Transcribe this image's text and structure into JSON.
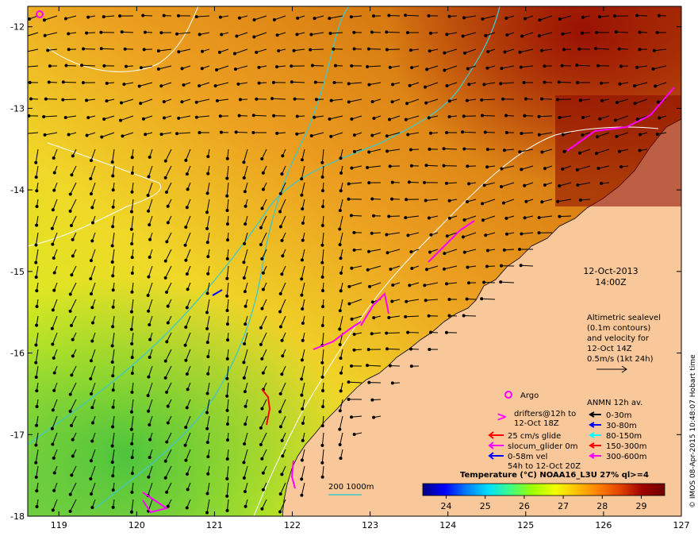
{
  "map": {
    "lon_ticks": [
      "119",
      "120",
      "121",
      "122",
      "123",
      "124",
      "125",
      "126",
      "127"
    ],
    "lat_ticks": [
      "-12",
      "-13",
      "-14",
      "-15",
      "-16",
      "-17",
      "-18"
    ],
    "lon_range": [
      118.6,
      127
    ],
    "lat_range": [
      -18,
      -11.75
    ]
  },
  "annotations": {
    "date": "12-Oct-2013",
    "time": "14:00Z",
    "alt_line1": "Altimetric sealevel",
    "alt_line2": "(0.1m contours)",
    "alt_line3": "and velocity for",
    "alt_line4": "12-Oct 14Z",
    "alt_line5": "0.5m/s (1kt 24h)",
    "argo": "Argo",
    "drifters_line1": "drifters@12h to",
    "drifters_line2": "12-Oct 18Z",
    "glide": "25 cm/s glide",
    "slocum": "slocum_glider 0m",
    "vel_line1": "0-58m vel",
    "vel_line2": "54h to 12-Oct 20Z",
    "anmn_title": "ANMN 12h av.",
    "anmn_items": [
      "0-30m",
      "30-80m",
      "80-150m",
      "150-300m",
      "300-600m"
    ],
    "anmn_colors": [
      "#000000",
      "#0000ff",
      "#00ffff",
      "#ff0000",
      "#ff00ff"
    ],
    "depth_label": "200  1000m",
    "credit": "© IMOS 08-Apr-2015 10:48:07 Hobart time"
  },
  "colorbar": {
    "title": "Temperature (°C) NOAA16_L3U 27% ql>=4",
    "ticks": [
      "24",
      "25",
      "26",
      "27",
      "28",
      "29"
    ],
    "colors": [
      "#000080",
      "#0000ff",
      "#0080ff",
      "#00e0ff",
      "#40ff80",
      "#a0ff00",
      "#f0ff00",
      "#ffc000",
      "#ff8000",
      "#e04000",
      "#a00000",
      "#700000"
    ]
  },
  "colors": {
    "land": "#f8c89a",
    "warm": "#e07a10",
    "mid": "#f2b020",
    "cool": "#d8e820",
    "cold": "#70d040"
  }
}
